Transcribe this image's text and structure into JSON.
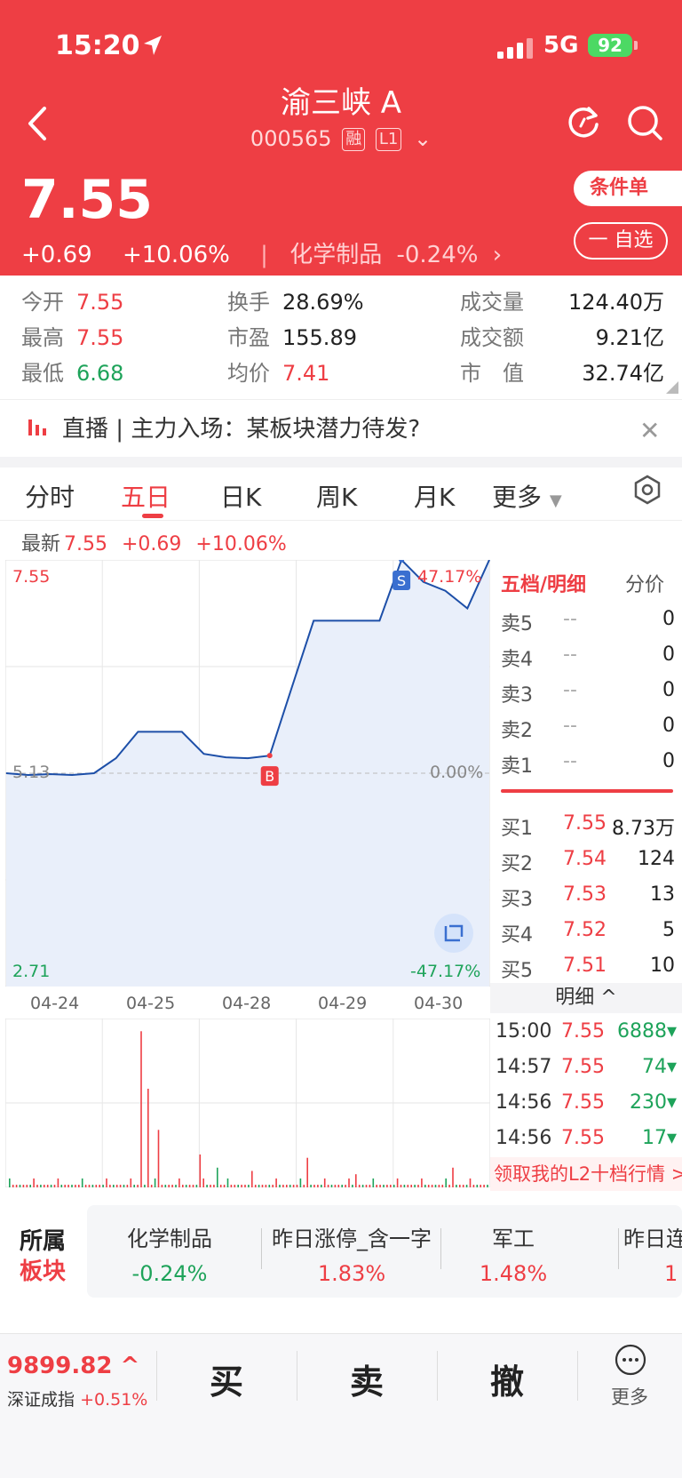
{
  "status_bar": {
    "time": "15:20",
    "network": "5G",
    "battery": "92"
  },
  "header": {
    "title": "渝三峡 A",
    "code": "000565",
    "tags": [
      "融",
      "L1"
    ],
    "price": "7.55",
    "change": "+0.69",
    "change_pct": "+10.06%",
    "industry": "化学制品",
    "industry_pct": "-0.24%",
    "condition_btn": "条件单",
    "watch_btn": "一 自选"
  },
  "quote": {
    "open_label": "今开",
    "open": "7.55",
    "high_label": "最高",
    "high": "7.55",
    "low_label": "最低",
    "low": "6.68",
    "turnover_label": "换手",
    "turnover": "28.69%",
    "pe_label": "市盈",
    "pe": "155.89",
    "avg_label": "均价",
    "avg": "7.41",
    "volume_label": "成交量",
    "volume": "124.40万",
    "amount_label": "成交额",
    "amount": "9.21亿",
    "mcap_label": "市　值",
    "mcap": "32.74亿"
  },
  "live": {
    "label": "直播",
    "text": "主力入场：某板块潜力待发?"
  },
  "tabs": [
    "分时",
    "五日",
    "日K",
    "周K",
    "月K",
    "更多"
  ],
  "active_tab": 1,
  "latest": {
    "label": "最新",
    "price": "7.55",
    "change": "+0.69",
    "pct": "+10.06%"
  },
  "chart_data": {
    "type": "line",
    "x": [
      "04-24",
      "04-25",
      "04-28",
      "04-29",
      "04-30"
    ],
    "ylim": [
      2.71,
      7.55
    ],
    "y_top_label": "7.55",
    "y_bottom_label": "2.71",
    "y_mid_label": "5.13",
    "pct_top": "47.17%",
    "pct_mid": "0.00%",
    "pct_bottom": "-47.17%",
    "markers": {
      "buy": "B",
      "sell": "S"
    },
    "series": [
      {
        "values": [
          5.13,
          5.11,
          5.12,
          5.11,
          5.13,
          5.3,
          5.6,
          5.6,
          5.6,
          5.35,
          5.31,
          5.3,
          5.33,
          6.1,
          6.86,
          6.86,
          6.86,
          6.86,
          7.55,
          7.3,
          7.2,
          7.0,
          7.55
        ]
      }
    ]
  },
  "order_book": {
    "title": "五档/明细",
    "tab2": "分价",
    "asks": [
      {
        "label": "卖5",
        "price": "--",
        "vol": "0"
      },
      {
        "label": "卖4",
        "price": "--",
        "vol": "0"
      },
      {
        "label": "卖3",
        "price": "--",
        "vol": "0"
      },
      {
        "label": "卖2",
        "price": "--",
        "vol": "0"
      },
      {
        "label": "卖1",
        "price": "--",
        "vol": "0"
      }
    ],
    "bids": [
      {
        "label": "买1",
        "price": "7.55",
        "vol": "8.73万"
      },
      {
        "label": "买2",
        "price": "7.54",
        "vol": "124"
      },
      {
        "label": "买3",
        "price": "7.53",
        "vol": "13"
      },
      {
        "label": "买4",
        "price": "7.52",
        "vol": "5"
      },
      {
        "label": "买5",
        "price": "7.51",
        "vol": "10"
      }
    ],
    "detail_label": "明细 ^",
    "ticks": [
      {
        "time": "15:00",
        "price": "7.55",
        "vol": "6888▾"
      },
      {
        "time": "14:57",
        "price": "7.55",
        "vol": "74▾"
      },
      {
        "time": "14:56",
        "price": "7.55",
        "vol": "230▾"
      },
      {
        "time": "14:56",
        "price": "7.55",
        "vol": "17▾"
      }
    ],
    "l2_promo": "领取我的L2十档行情 >"
  },
  "sectors": {
    "label_line1": "所属",
    "label_line2": "板块",
    "items": [
      {
        "name": "化学制品",
        "pct": "-0.24%"
      },
      {
        "name": "昨日涨停_含一字",
        "pct": "1.83%"
      },
      {
        "name": "军工",
        "pct": "1.48%"
      },
      {
        "name": "昨日连",
        "pct": "1"
      }
    ]
  },
  "bottom_bar": {
    "index_value": "9899.82 ^",
    "index_name": "深证成指",
    "index_pct": "+0.51%",
    "buy": "买",
    "sell": "卖",
    "cancel": "撤",
    "more": "更多"
  },
  "colors": {
    "up": "#ee3e44",
    "down": "#1ea35a",
    "line": "#1d4fa8"
  }
}
